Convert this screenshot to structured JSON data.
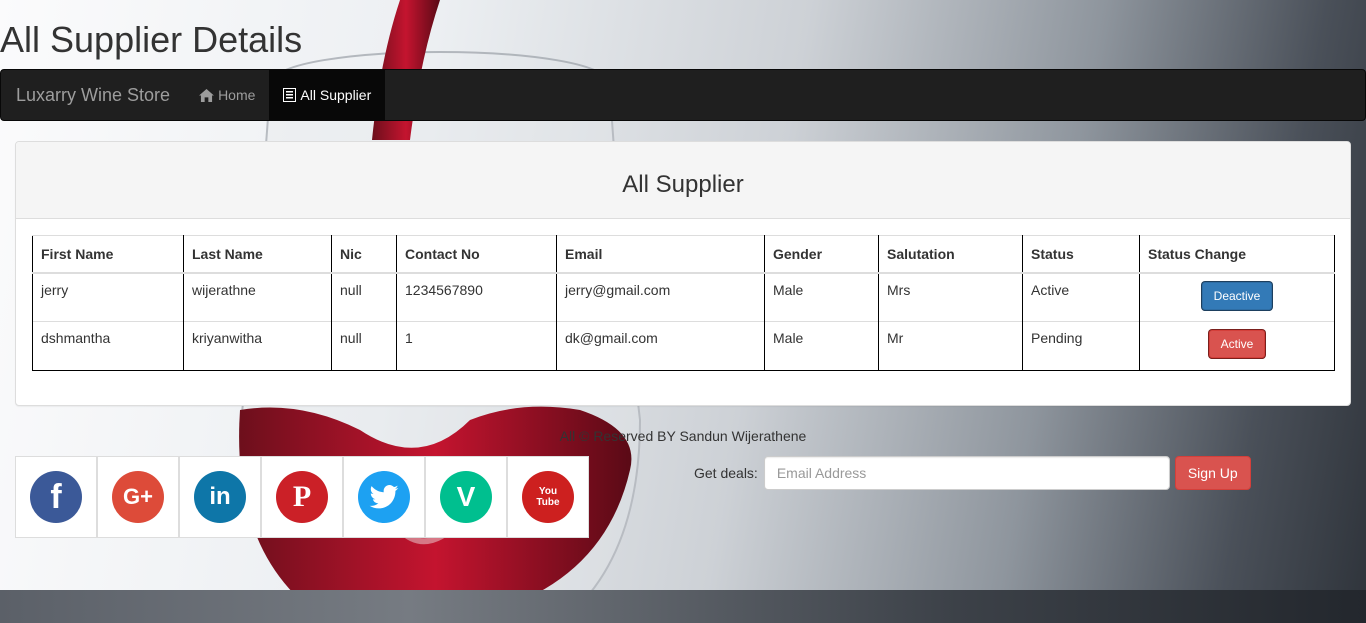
{
  "page": {
    "title": "All Supplier Details"
  },
  "navbar": {
    "brand": "Luxarry Wine Store",
    "items": [
      {
        "label": "Home",
        "icon": "home-icon",
        "active": false
      },
      {
        "label": "All Supplier",
        "icon": "list-icon",
        "active": true
      }
    ]
  },
  "panel": {
    "heading": "All Supplier"
  },
  "table": {
    "headers": [
      "First Name",
      "Last Name",
      "Nic",
      "Contact No",
      "Email",
      "Gender",
      "Salutation",
      "Status",
      "Status Change"
    ],
    "rows": [
      {
        "first_name": "jerry",
        "last_name": "wijerathne",
        "nic": "null",
        "contact": "1234567890",
        "email": "jerry@gmail.com",
        "gender": "Male",
        "salutation": "Mrs",
        "status": "Active",
        "action": "Deactive",
        "action_color": "#337ab7"
      },
      {
        "first_name": "dshmantha",
        "last_name": "kriyanwitha",
        "nic": "null",
        "contact": "1",
        "email": "dk@gmail.com",
        "gender": "Male",
        "salutation": "Mr",
        "status": "Pending",
        "action": "Active",
        "action_color": "#d9534f"
      }
    ]
  },
  "footer": {
    "copyright": "All © Reserved BY Sandun Wijerathene",
    "deals_label": "Get deals:",
    "email_placeholder": "Email Address",
    "signup_label": "Sign Up"
  },
  "social": [
    {
      "icon": "facebook-icon",
      "glyph": "f",
      "color": "#3b5998"
    },
    {
      "icon": "google-plus-icon",
      "glyph": "G+",
      "color": "#dd4b39"
    },
    {
      "icon": "linkedin-icon",
      "glyph": "in",
      "color": "#0e76a8"
    },
    {
      "icon": "pinterest-icon",
      "glyph": "P",
      "color": "#cb2027"
    },
    {
      "icon": "twitter-icon",
      "glyph": "t",
      "color": "#1da1f2"
    },
    {
      "icon": "vine-icon",
      "glyph": "V",
      "color": "#00bf8f"
    },
    {
      "icon": "youtube-icon",
      "glyph": "You\nTube",
      "color": "#cd201f"
    }
  ]
}
